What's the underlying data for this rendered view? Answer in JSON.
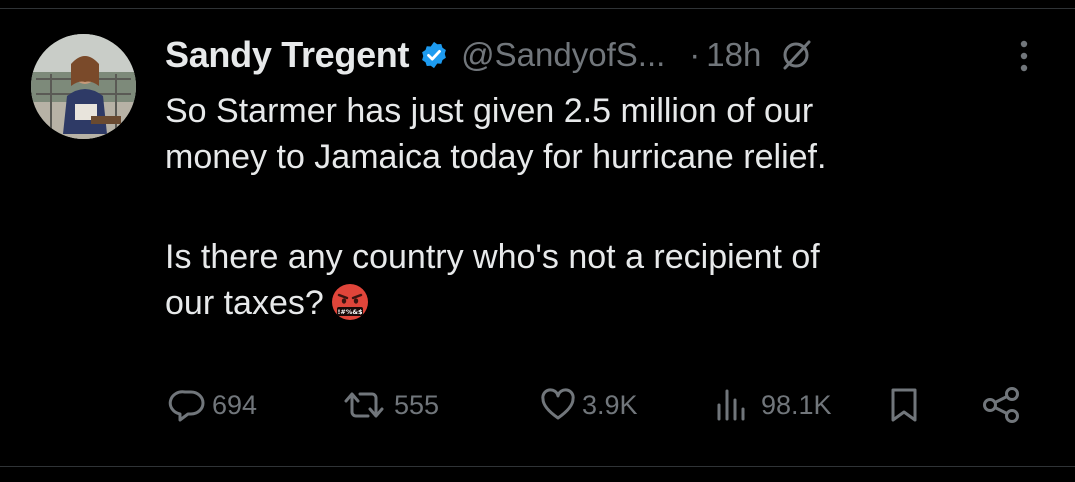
{
  "tweet": {
    "display_name": "Sandy Tregent",
    "handle": "@SandyofS...",
    "separator": "·",
    "time": "18h",
    "body_line1": "So Starmer has just given 2.5 million of our",
    "body_line2": "money to Jamaica today for hurricane relief.",
    "body_line3": "Is there any country who's not a recipient of",
    "body_line4": "our taxes?",
    "emoji_name": "face-with-symbols-on-mouth",
    "emoji_symbols": "!#%&$"
  },
  "icons": {
    "verified": "verified-badge-icon",
    "grok": "grok-icon",
    "more": "more-icon",
    "reply": "reply-icon",
    "repost": "repost-icon",
    "like": "heart-icon",
    "views": "views-icon",
    "bookmark": "bookmark-icon",
    "share": "share-icon"
  },
  "metrics": {
    "replies": "694",
    "reposts": "555",
    "likes": "3.9K",
    "views": "98.1K"
  },
  "colors": {
    "background": "#000000",
    "text_primary": "#e7e9ea",
    "text_secondary": "#71767b",
    "verified_blue": "#1d9bf0",
    "divider": "#2f3336"
  }
}
